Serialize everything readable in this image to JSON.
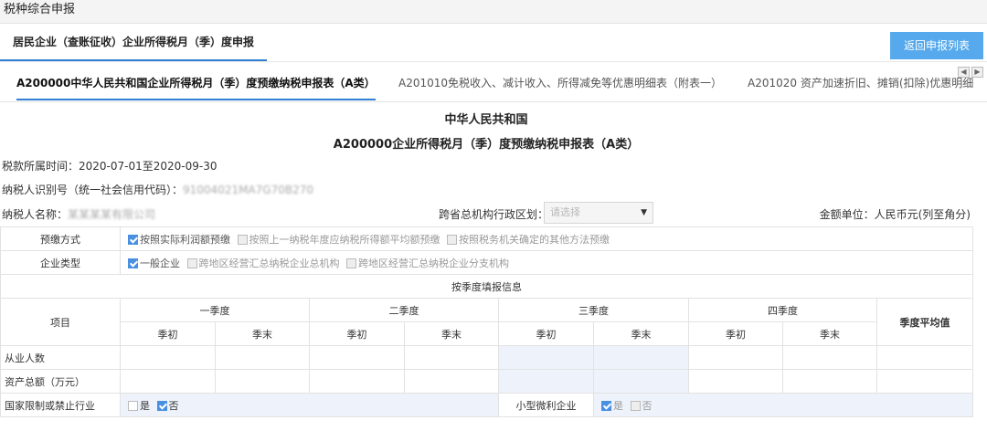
{
  "page_title": "税种综合申报",
  "subtab": {
    "label": "居民企业（查账征收）企业所得税月（季）度申报"
  },
  "return_button": "返回申报列表",
  "form_tabs": [
    "A200000中华人民共和国企业所得税月（季）度预缴纳税申报表（A类）",
    "A201010免税收入、减计收入、所得减免等优惠明细表（附表一）",
    "A201020 资产加速折旧、摊销(扣除)优惠明细"
  ],
  "form_heading_1": "中华人民共和国",
  "form_heading_2": "A200000企业所得税月（季）度预缴纳税申报表（A类）",
  "tax_period": "税款所属时间：2020-07-01至2020-09-30",
  "taxpayer_id": {
    "label": "纳税人识别号（统一社会信用代码）：",
    "value": "91004021MA7G70B270"
  },
  "taxpayer_name": {
    "label": "纳税人名称：",
    "value": "某某某某有限公司"
  },
  "region": {
    "label": "跨省总机构行政区划：",
    "placeholder": "请选择"
  },
  "unit": "金额单位：人民币元(列至角分)",
  "prepay_method": {
    "label": "预缴方式",
    "options": [
      {
        "text": "按照实际利润额预缴",
        "checked": true
      },
      {
        "text": "按照上一纳税年度应纳税所得额平均额预缴",
        "checked": false
      },
      {
        "text": "按照税务机关确定的其他方法预缴",
        "checked": false
      }
    ]
  },
  "enterprise_type": {
    "label": "企业类型",
    "options": [
      {
        "text": "一般企业",
        "checked": true
      },
      {
        "text": "跨地区经营汇总纳税企业总机构",
        "checked": false
      },
      {
        "text": "跨地区经营汇总纳税企业分支机构",
        "checked": false
      }
    ]
  },
  "quarterly_section": "按季度填报信息",
  "grid": {
    "item_header": "项目",
    "quarters": [
      "一季度",
      "二季度",
      "三季度",
      "四季度"
    ],
    "start": "季初",
    "end": "季末",
    "avg": "季度平均值",
    "row_employees": "从业人数",
    "row_assets": "资产总额（万元）",
    "row_restricted": "国家限制或禁止行业",
    "yes": "是",
    "no": "否",
    "row_small": "小型微利企业"
  },
  "colors": {
    "accent": "#2f7fd2",
    "button": "#55a9ec",
    "avg_red": "#e02020",
    "highlight": "#eef3fb"
  }
}
